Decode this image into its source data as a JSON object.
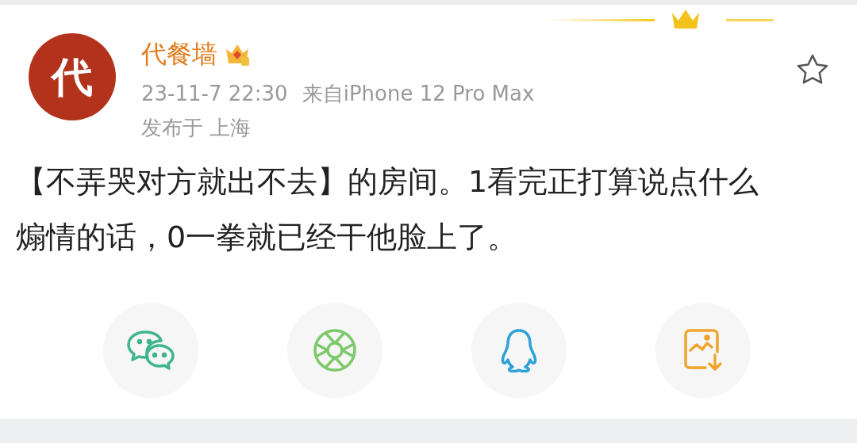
{
  "post": {
    "avatar_text": "代",
    "author": "代餐墙",
    "timestamp": "23-11-7 22:30",
    "source": "来自iPhone 12 Pro Max",
    "location": "发布于 上海",
    "favorited": false,
    "text": "【不弄哭对方就出不去】的房间。1看完正打算说点什么煽情的话，0一拳就已经干他脸上了。"
  },
  "share_buttons": [
    {
      "kind": "wechat"
    },
    {
      "kind": "moments"
    },
    {
      "kind": "qq"
    },
    {
      "kind": "save_image"
    }
  ]
}
